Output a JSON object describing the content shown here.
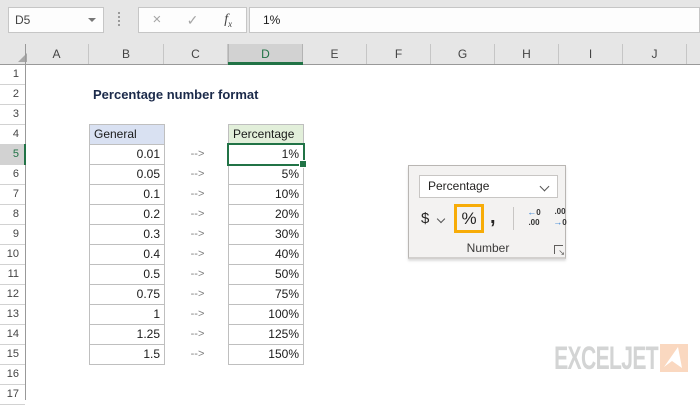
{
  "formula_bar": {
    "cell_reference": "D5",
    "formula_value": "1%",
    "fx_label": "f",
    "fx_sub": "x"
  },
  "icons": {
    "cancel": "×",
    "enter": "✓",
    "increase_decimal_arrow": "←",
    "decrease_decimal_arrow": "→"
  },
  "grid": {
    "column_headers": [
      "A",
      "B",
      "C",
      "D",
      "E",
      "F",
      "G",
      "H",
      "I",
      "J"
    ],
    "row_numbers": [
      "1",
      "2",
      "3",
      "4",
      "5",
      "6",
      "7",
      "8",
      "9",
      "10",
      "11",
      "12",
      "13",
      "14",
      "15",
      "16",
      "17"
    ],
    "selected_cell": "D5"
  },
  "sheet": {
    "title": "Percentage number format",
    "table": {
      "source_header": "General",
      "result_header": "Percentage",
      "arrow": "-->",
      "rows": [
        {
          "general": "0.01",
          "percentage": "1%"
        },
        {
          "general": "0.05",
          "percentage": "5%"
        },
        {
          "general": "0.1",
          "percentage": "10%"
        },
        {
          "general": "0.2",
          "percentage": "20%"
        },
        {
          "general": "0.3",
          "percentage": "30%"
        },
        {
          "general": "0.4",
          "percentage": "40%"
        },
        {
          "general": "0.5",
          "percentage": "50%"
        },
        {
          "general": "0.75",
          "percentage": "75%"
        },
        {
          "general": "1",
          "percentage": "100%"
        },
        {
          "general": "1.25",
          "percentage": "125%"
        },
        {
          "general": "1.5",
          "percentage": "150%"
        }
      ]
    }
  },
  "number_group": {
    "format_dropdown_value": "Percentage",
    "currency_label": "$",
    "percent_label": "%",
    "comma_label": ",",
    "increase_decimal_digit": "0",
    "increase_decimal_decimals": ".00",
    "decrease_decimal_decimals": ".00",
    "decrease_decimal_digit": "0",
    "group_label": "Number"
  },
  "logo": {
    "text": "EXCELJET"
  },
  "colors": {
    "selection_green": "#217346",
    "highlight_orange": "#f7ac08",
    "general_header_fill": "#d9e1f2",
    "percentage_header_fill": "#e2efda",
    "logo_square": "#fad8c0"
  }
}
